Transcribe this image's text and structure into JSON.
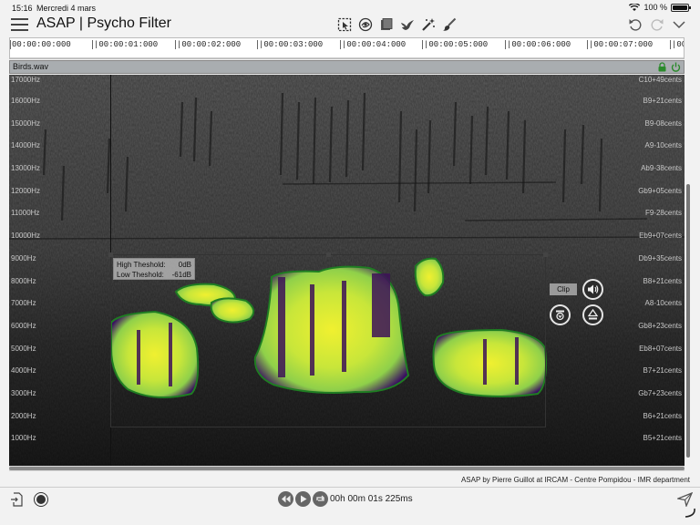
{
  "status": {
    "time": "15:16",
    "date": "Mercredi 4 mars",
    "battery": "100 %",
    "battery_level": 1.0
  },
  "app": {
    "title": "ASAP | Psycho Filter"
  },
  "toolbar": {
    "left_icons": [
      "select-region-icon",
      "lasso-icon",
      "eraser-icon",
      "bird-icon",
      "magic-wand-icon",
      "brush-icon"
    ],
    "right_icons": [
      "undo-icon",
      "redo-icon",
      "chevron-down-icon"
    ]
  },
  "ruler": {
    "ticks": [
      "00:00:00:000",
      "|00:00:01:000",
      "|00:00:02:000",
      "|00:00:03:000",
      "|00:00:04:000",
      "|00:00:05:000",
      "|00:00:06:000",
      "|00:00:07:000",
      "|00:0"
    ]
  },
  "track": {
    "name": "Birds.wav"
  },
  "spectrogram": {
    "freq_labels": [
      "17000Hz",
      "16000Hz",
      "15000Hz",
      "14000Hz",
      "13000Hz",
      "12000Hz",
      "11000Hz",
      "10000Hz",
      "9000Hz",
      "8000Hz",
      "7000Hz",
      "6000Hz",
      "5000Hz",
      "4000Hz",
      "3000Hz",
      "2000Hz",
      "1000Hz"
    ],
    "note_labels": [
      "C10+49cents",
      "B9+21cents",
      "B9-08cents",
      "A9-10cents",
      "Ab9-38cents",
      "Gb9+05cents",
      "F9-28cents",
      "Eb9+07cents",
      "Db9+35cents",
      "B8+21cents",
      "A8-10cents",
      "Gb8+23cents",
      "Eb8+07cents",
      "B7+21cents",
      "Gb7+23cents",
      "B6+21cents",
      "B5+21cents"
    ],
    "threshold": {
      "high_label": "High Theshold:",
      "high_value": "0dB",
      "low_label": "Low Theshold:",
      "low_value": "-61dB"
    }
  },
  "clip": {
    "label": "Clip"
  },
  "footer": {
    "credit": "ASAP by Pierre Guillot at IRCAM - Centre Pompidou - IMR department"
  },
  "transport": {
    "timecode": "00h 00m 01s 225ms"
  }
}
